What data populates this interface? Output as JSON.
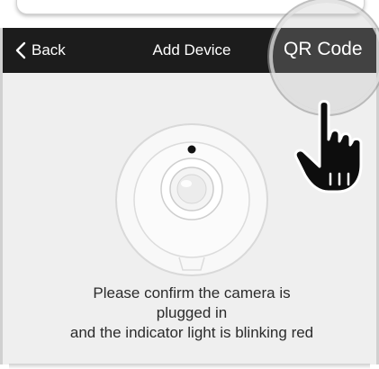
{
  "navbar": {
    "back_label": "Back",
    "title": "Add Device",
    "qr_label": "QR Code"
  },
  "instruction": {
    "line1": "Please confirm the camera is",
    "line2": "plugged in",
    "line3": "and the indicator light is blinking red"
  },
  "icons": {
    "back": "chevron-left-icon",
    "camera": "camera-illustration",
    "hand": "pointing-hand-icon"
  },
  "colors": {
    "navbar_bg": "#1c1c1c",
    "screen_bg": "#efefef",
    "text": "#2b2b2b"
  }
}
